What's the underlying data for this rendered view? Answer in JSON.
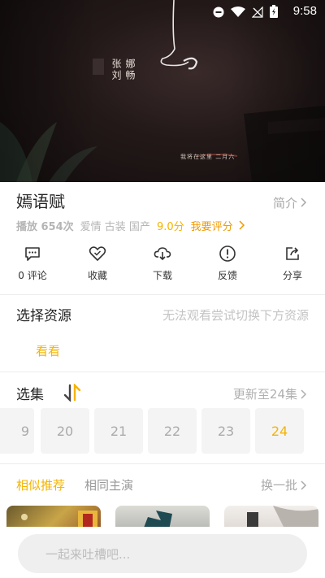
{
  "status_bar": {
    "time": "9:58"
  },
  "poster": {
    "line1": "张刘",
    "line2": "娜畅",
    "small_text": "我将在这里 二月六"
  },
  "show": {
    "title": "嫣语赋",
    "intro_label": "简介",
    "plays": "播放 654次",
    "tags": "爱情 古装 国产",
    "score": "9.0分",
    "rate_label": "我要评分"
  },
  "actions": [
    {
      "label": "0 评论",
      "icon": "comment-icon"
    },
    {
      "label": "收藏",
      "icon": "heart-icon"
    },
    {
      "label": "下载",
      "icon": "cloud-download-icon"
    },
    {
      "label": "反馈",
      "icon": "feedback-icon"
    },
    {
      "label": "分享",
      "icon": "share-icon"
    }
  ],
  "source": {
    "title": "选择资源",
    "hint": "无法观看尝试切换下方资源",
    "items": [
      "看看"
    ]
  },
  "episodes": {
    "title": "选集",
    "updated": "更新至24集",
    "partial": "9",
    "list": [
      "20",
      "21",
      "22",
      "23",
      "24"
    ],
    "active": "24"
  },
  "recommend": {
    "tabs": [
      "相似推荐",
      "相同主演"
    ],
    "refresh": "换一批"
  },
  "comment": {
    "placeholder": "一起来吐槽吧..."
  },
  "colors": {
    "accent": "#f5b400",
    "rate": "#f09a00"
  }
}
